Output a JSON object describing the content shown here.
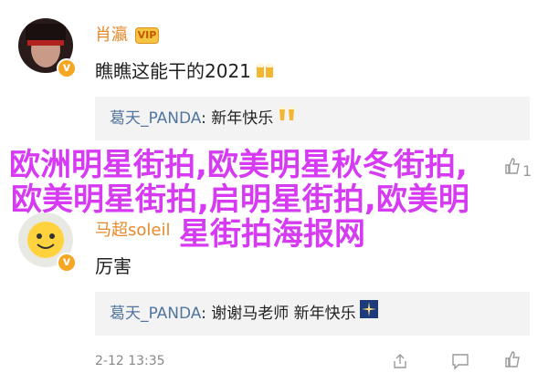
{
  "comments": [
    {
      "username": "肖瀛",
      "vip_label": "VIP",
      "content": "瞧瞧这能干的2021",
      "emoji": "beer-icon",
      "reply": {
        "user": "葛天_PANDA",
        "separator": ": ",
        "text": "新年快乐",
        "emoji": "cheers-icon"
      }
    },
    {
      "username": "马超soleil",
      "content": "厉害",
      "reply": {
        "user": "葛天_PANDA",
        "separator": ": ",
        "text": "谢谢马老师 新年快乐",
        "emoji": "sparkle-icon"
      },
      "timestamp": "2-12 13:35"
    }
  ],
  "like_count": "1",
  "overlay": {
    "line1": "欧洲明星街拍,欧美明星秋冬街拍,",
    "line2": "欧美明星街拍,启明星街拍,欧美明",
    "line3": "星街拍海报网"
  },
  "colors": {
    "username": "#e5892b",
    "reply_user": "#52759f",
    "overlay_text": "#d63af3",
    "reply_bg": "#f3f3f3"
  }
}
